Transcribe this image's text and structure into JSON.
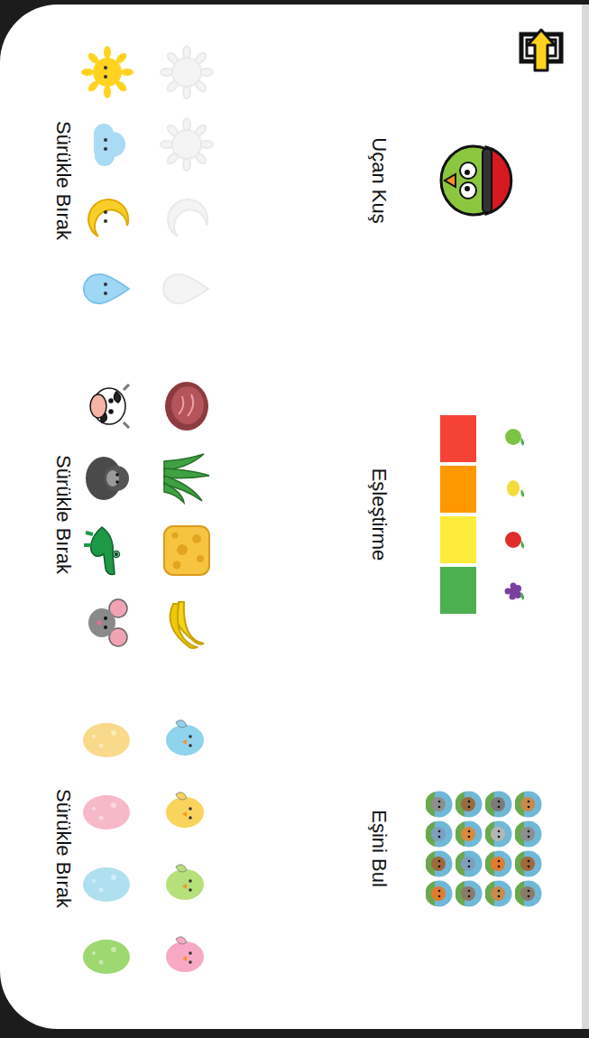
{
  "games": [
    {
      "kind": "flappy",
      "title": "Uçan Kuş",
      "drag": {
        "kind": "weather",
        "label": "Sürükle Bırak"
      }
    },
    {
      "kind": "colors",
      "title": "Eşleştirme",
      "swatches": [
        {
          "color": "#f44336"
        },
        {
          "color": "#ff9800"
        },
        {
          "color": "#ffeb3b"
        },
        {
          "color": "#4caf50"
        }
      ],
      "drag": {
        "kind": "food",
        "label": "Sürükle Bırak"
      }
    },
    {
      "kind": "memory",
      "title": "Eşini Bul",
      "drag": {
        "kind": "eggs",
        "label": "Sürükle Bırak",
        "birds": [
          {
            "color": "#8fd3ee"
          },
          {
            "color": "#f9d45c"
          },
          {
            "color": "#b5e07a"
          },
          {
            "color": "#f7a8c4"
          }
        ],
        "eggs": [
          {
            "color": "#f9d98a"
          },
          {
            "color": "#f7b8c8"
          },
          {
            "color": "#aee0ef"
          },
          {
            "color": "#9ed870"
          }
        ]
      }
    }
  ]
}
